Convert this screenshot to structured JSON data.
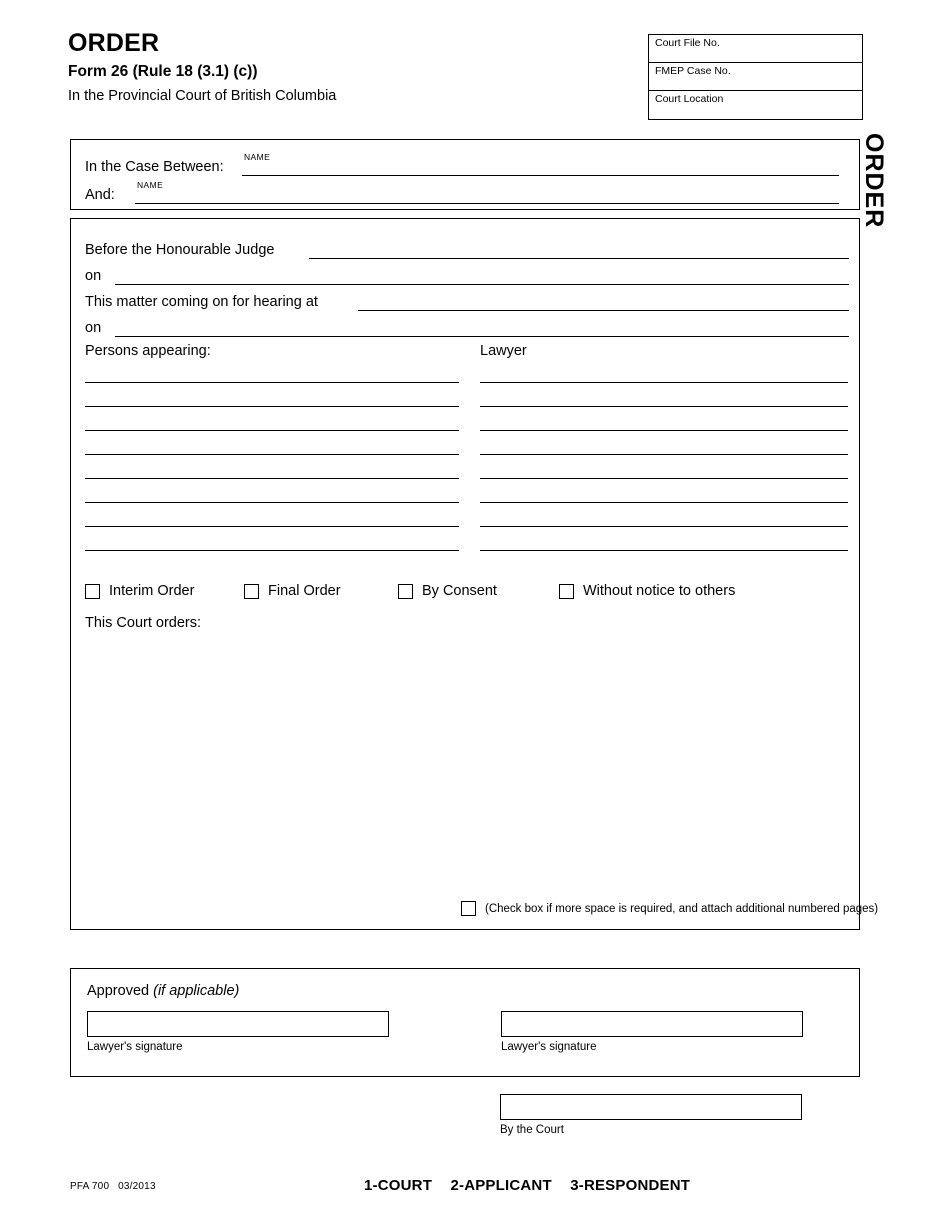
{
  "header": {
    "title": "ORDER",
    "form_subtitle": "Form 26 (Rule 18 (3.1) (c))",
    "court_line": "In the Provincial Court of British Columbia",
    "vertical_tab": "ORDER",
    "file_boxes": [
      {
        "label": "Court File No.",
        "value": ""
      },
      {
        "label": "FMEP Case No.",
        "value": ""
      },
      {
        "label": "Court Location",
        "value": ""
      }
    ]
  },
  "parties": {
    "between_label": "In the Case Between:",
    "and_label": "And:",
    "name_tag": "NAME",
    "between_value": "",
    "and_value": ""
  },
  "hearing": {
    "judge_label": "Before the Honourable Judge",
    "judge_value": "",
    "judge_date_label": "on",
    "judge_date_value": "",
    "hearing_at_label": "This matter coming on for hearing at",
    "hearing_at_value": "",
    "hearing_date_label": "on",
    "hearing_date_value": ""
  },
  "appearances": {
    "persons_heading": "Persons appearing:",
    "lawyer_heading": "Lawyer",
    "persons_rows": [
      "",
      "",
      "",
      "",
      "",
      "",
      "",
      ""
    ],
    "lawyer_rows": [
      "",
      "",
      "",
      "",
      "",
      "",
      "",
      ""
    ]
  },
  "order_type": {
    "options": [
      {
        "label": "Interim Order",
        "checked": false
      },
      {
        "label": "Final Order",
        "checked": false
      },
      {
        "label": "By Consent",
        "checked": false
      },
      {
        "label": "Without notice to others",
        "checked": false
      }
    ]
  },
  "orders": {
    "heading": "This Court orders:",
    "body": "",
    "more_space_note": "(Check box if more space is required, and attach additional numbered pages)",
    "more_space_checked": false
  },
  "approved": {
    "title_main": "Approved ",
    "title_italic": "(if applicable)",
    "signature_left_caption": "Lawyer's signature",
    "signature_left_value": "",
    "signature_right_caption": "Lawyer's signature",
    "signature_right_value": "",
    "court_caption": "By the Court",
    "court_value": ""
  },
  "footer": {
    "form_number": "PFA 700",
    "revision_date": "03/2013",
    "copies": [
      "1-COURT",
      "2-APPLICANT",
      "3-RESPONDENT"
    ]
  }
}
